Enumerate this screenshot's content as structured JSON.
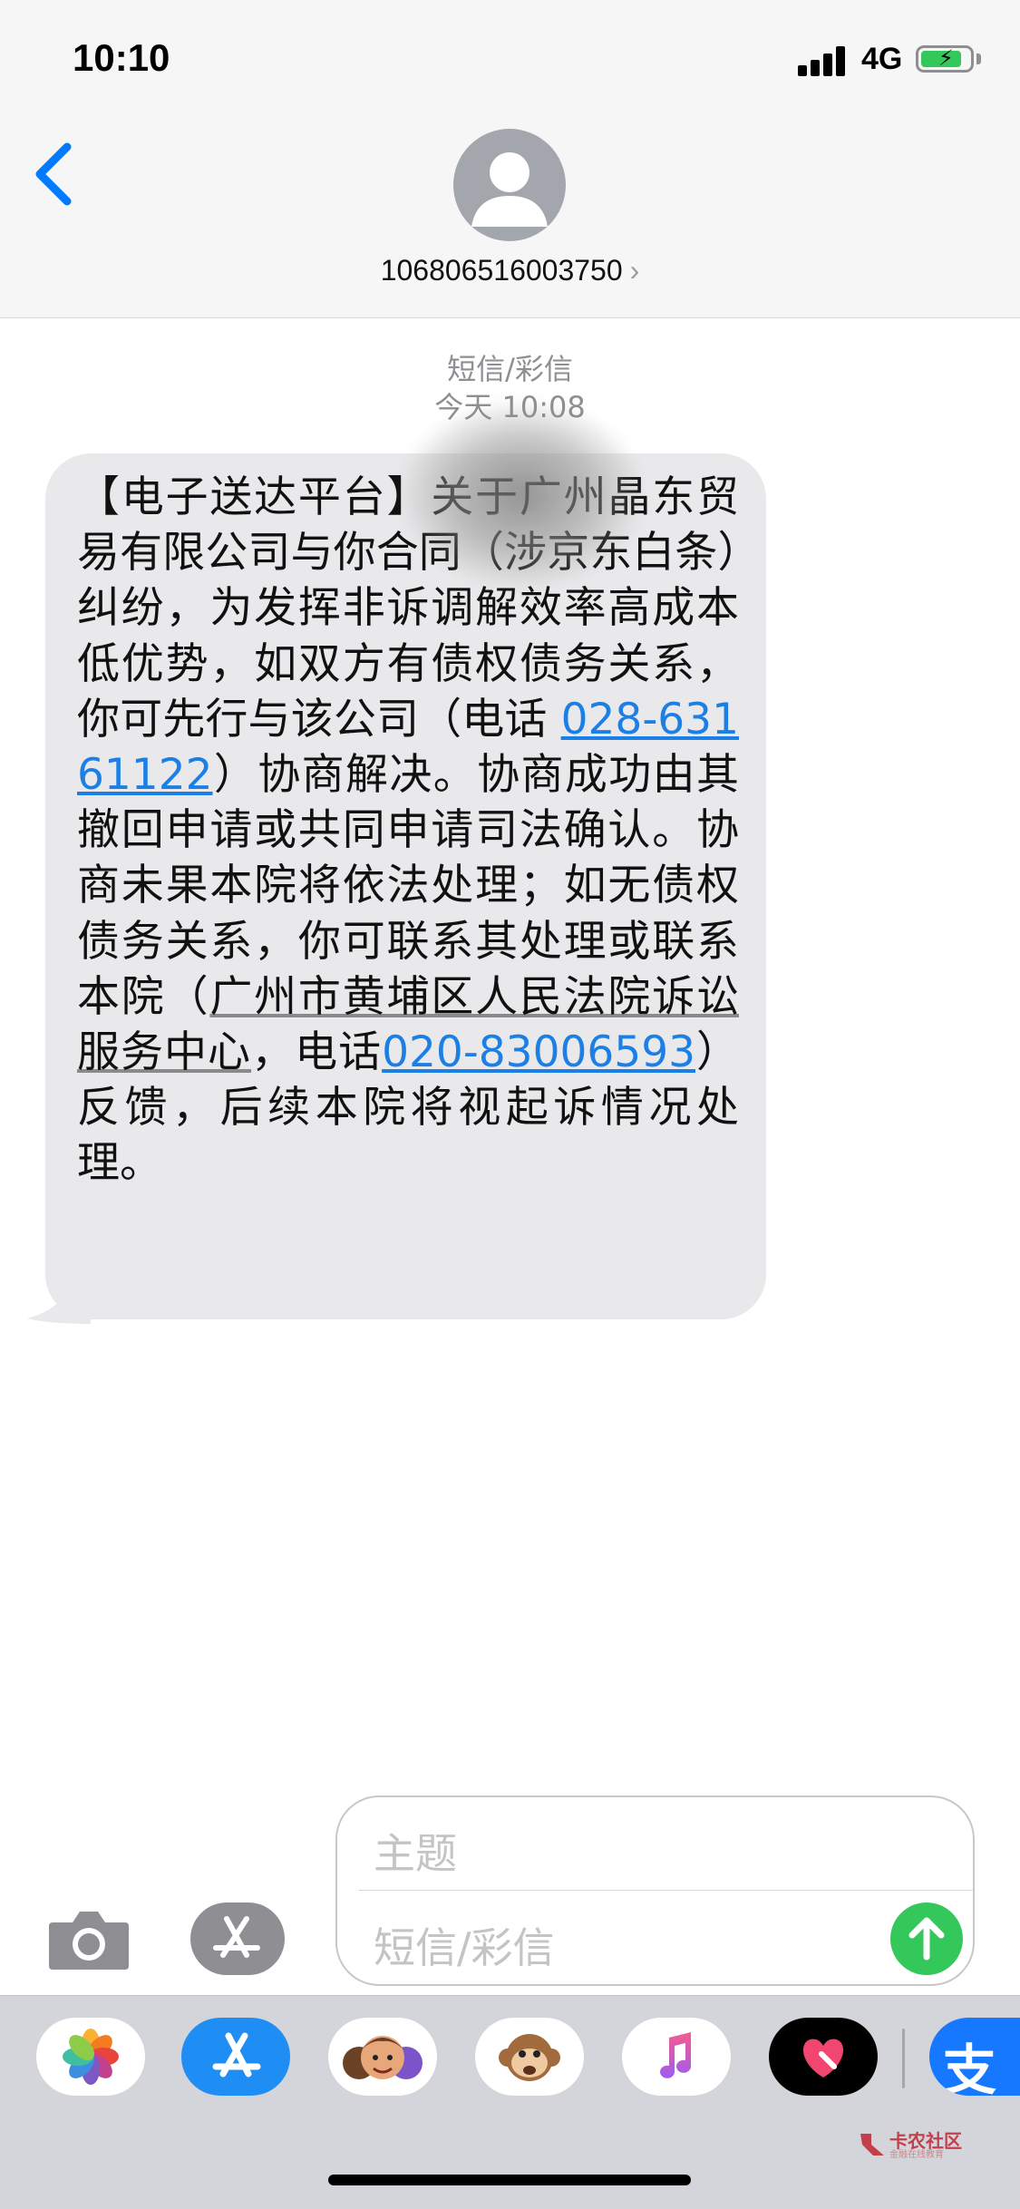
{
  "status_bar": {
    "time": "10:10",
    "network": "4G",
    "battery_level": 0.8,
    "charging": true
  },
  "header": {
    "contact_number": "106806516003750",
    "chevron": "›"
  },
  "conversation": {
    "service_label": "短信/彩信",
    "timestamp": "今天 10:08",
    "message": {
      "part1": "【电子送达平台】",
      "part2": "关于广州晶东贸易有限公司与你合同（涉京东白条）纠纷，为发挥非诉调解效率高成本低优势，如双方有债权债务关系，你可先行与该公司（电话 ",
      "phone1": "028-63161122",
      "part3": "）协商解决。协商成功由其撤回申请或共同申请司法确认。协商未果本院将依法处理；如无债权债务关系，你可联系其处理或联系本院（",
      "court_center": "广州市黄埔区人民法院诉讼服务中心",
      "part4": "，电话",
      "phone2": "020-83006593",
      "part5": "）反馈，后续本院将视起诉情况处理。"
    }
  },
  "compose": {
    "subject_placeholder": "主题",
    "message_placeholder": "短信/彩信"
  },
  "app_drawer": {
    "apps": [
      "photos-app",
      "app-store-app",
      "memoji-app",
      "animoji-app",
      "music-app",
      "digital-touch-app",
      "alipay-app"
    ],
    "alipay_glyph": "支"
  },
  "watermark": {
    "name": "卡农社区",
    "subtitle": "金融在线教育"
  },
  "colors": {
    "link": "#1c7fe6",
    "bubble": "#e9e9eb",
    "send": "#34c759",
    "ios_blue": "#007aff"
  }
}
